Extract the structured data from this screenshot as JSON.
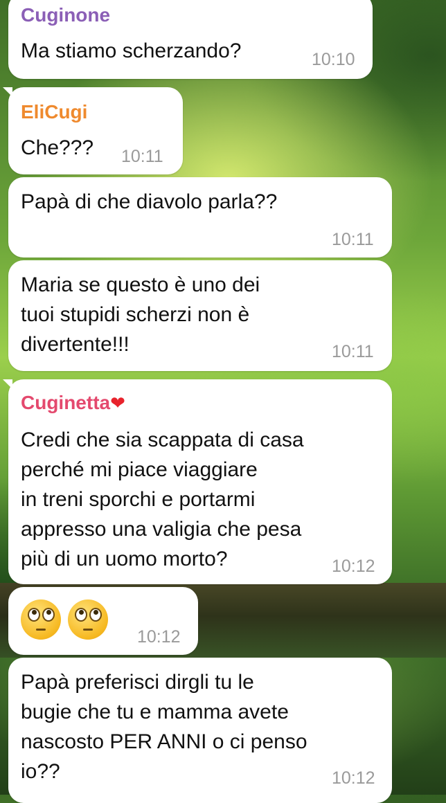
{
  "theme": {
    "bubble_bg": "#ffffff",
    "time_color": "#9a9a9a",
    "sender_colors": {
      "Cuginone": "#8b5fb6",
      "EliCugi": "#ef8a2e",
      "Cuginetta": "#e4496e"
    }
  },
  "messages": [
    {
      "sender": "Cuginone",
      "text": "Ma stiamo scherzando?",
      "time": "10:10"
    },
    {
      "sender": "EliCugi",
      "text": "Che???",
      "time": "10:11"
    },
    {
      "sender": "",
      "text": "Papà di che diavolo parla??",
      "time": "10:11"
    },
    {
      "sender": "",
      "text": "Maria se questo è uno dei\ntuoi stupidi scherzi non è\ndivertente!!!",
      "time": "10:11"
    },
    {
      "sender": "Cuginetta",
      "sender_emoji": "heart-emoji",
      "text": "Credi che sia scappata di casa\nperché mi piace viaggiare\nin treni sporchi e portarmi\nappresso una valigia che pesa\npiù di un uomo morto?",
      "time": "10:12"
    },
    {
      "sender": "",
      "emojis": [
        "face-with-rolling-eyes",
        "face-with-rolling-eyes"
      ],
      "time": "10:12"
    },
    {
      "sender": "",
      "text": "Papà preferisci dirgli tu le\nbugie che tu e mamma avete\nnascosto PER ANNI o ci penso\nio??",
      "time": "10:12"
    }
  ]
}
